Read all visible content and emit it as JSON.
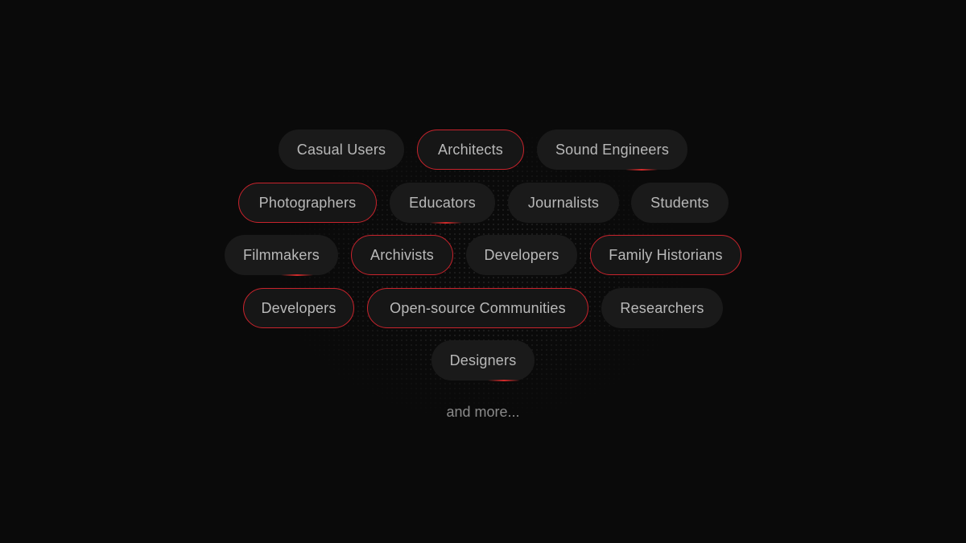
{
  "tags": [
    {
      "label": "Casual Users",
      "highlighted": false
    },
    {
      "label": "Architects",
      "highlighted": true
    },
    {
      "label": "Sound Engineers",
      "highlighted": false
    },
    {
      "label": "Photographers",
      "highlighted": true
    },
    {
      "label": "Educators",
      "highlighted": false
    },
    {
      "label": "Journalists",
      "highlighted": false
    },
    {
      "label": "Students",
      "highlighted": false
    },
    {
      "label": "Filmmakers",
      "highlighted": false
    },
    {
      "label": "Archivists",
      "highlighted": true
    },
    {
      "label": "Developers",
      "highlighted": false
    },
    {
      "label": "Family Historians",
      "highlighted": true
    },
    {
      "label": "Developers",
      "highlighted": true
    },
    {
      "label": "Open-source Communities",
      "highlighted": true
    },
    {
      "label": "Researchers",
      "highlighted": false
    },
    {
      "label": "Designers",
      "highlighted": false
    }
  ],
  "more_label": "and more...",
  "colors": {
    "accent": "#c8232c",
    "pill_bg": "#1a1a1a",
    "background": "#0a0a0a"
  }
}
